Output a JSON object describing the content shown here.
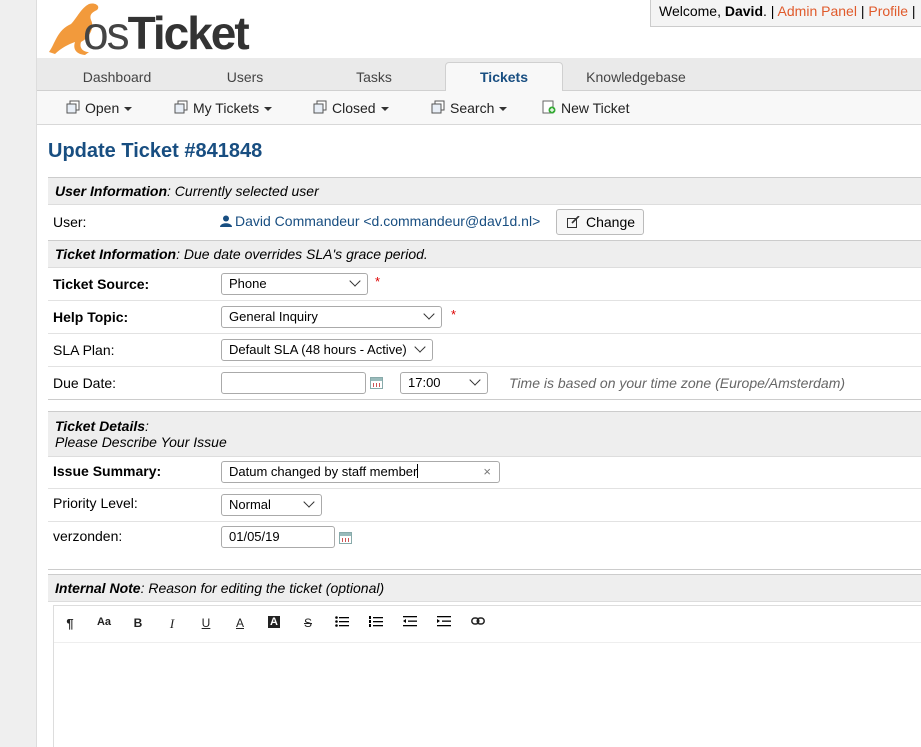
{
  "header": {
    "logo_text_os": "os",
    "logo_text_ticket": "Ticket",
    "welcome_prefix": "Welcome, ",
    "user_name": "David",
    "welcome_suffix": ". | ",
    "admin_panel": "Admin Panel",
    "sep": " | ",
    "profile": "Profile",
    "sep_end": " |"
  },
  "nav": {
    "tabs": [
      {
        "label": "Dashboard"
      },
      {
        "label": "Users"
      },
      {
        "label": "Tasks"
      },
      {
        "label": "Tickets"
      },
      {
        "label": "Knowledgebase"
      }
    ],
    "active": "Tickets"
  },
  "subnav": {
    "items": [
      {
        "label": "Open"
      },
      {
        "label": "My Tickets"
      },
      {
        "label": "Closed"
      },
      {
        "label": "Search"
      },
      {
        "label": "New Ticket"
      }
    ]
  },
  "page_title": "Update Ticket #841848",
  "user_section": {
    "head_bold": "User Information",
    "head_rest": ": Currently selected user",
    "user_label": "User:",
    "user_value": "David Commandeur <d.commandeur@dav1d.nl>",
    "change_button": "Change"
  },
  "ticket_info": {
    "head_bold": "Ticket Information",
    "head_rest": ": Due date overrides SLA's grace period.",
    "source_label": "Ticket Source:",
    "source_value": "Phone",
    "help_topic_label": "Help Topic:",
    "help_topic_value": "General Inquiry",
    "sla_label": "SLA Plan:",
    "sla_value": "Default SLA (48 hours - Active)",
    "due_label": "Due Date:",
    "due_value": "",
    "due_time": "17:00",
    "due_hint": "Time is based on your time zone (Europe/Amsterdam)",
    "required_mark": "*"
  },
  "ticket_details": {
    "head_bold": "Ticket Details",
    "head_rest": ":",
    "head_line2": "Please Describe Your Issue",
    "summary_label": "Issue Summary:",
    "summary_value": "Datum changed by staff member",
    "priority_label": "Priority Level:",
    "priority_value": "Normal",
    "verzonden_label": "verzonden:",
    "verzonden_value": "01/05/19"
  },
  "internal_note": {
    "head_bold": "Internal Note",
    "head_rest": ": Reason for editing the ticket (optional)",
    "toolbar": [
      "¶",
      "Aa",
      "B",
      "I",
      "U",
      "A",
      "A",
      "S",
      "list-bullet",
      "list-number",
      "outdent",
      "indent",
      "link"
    ]
  }
}
